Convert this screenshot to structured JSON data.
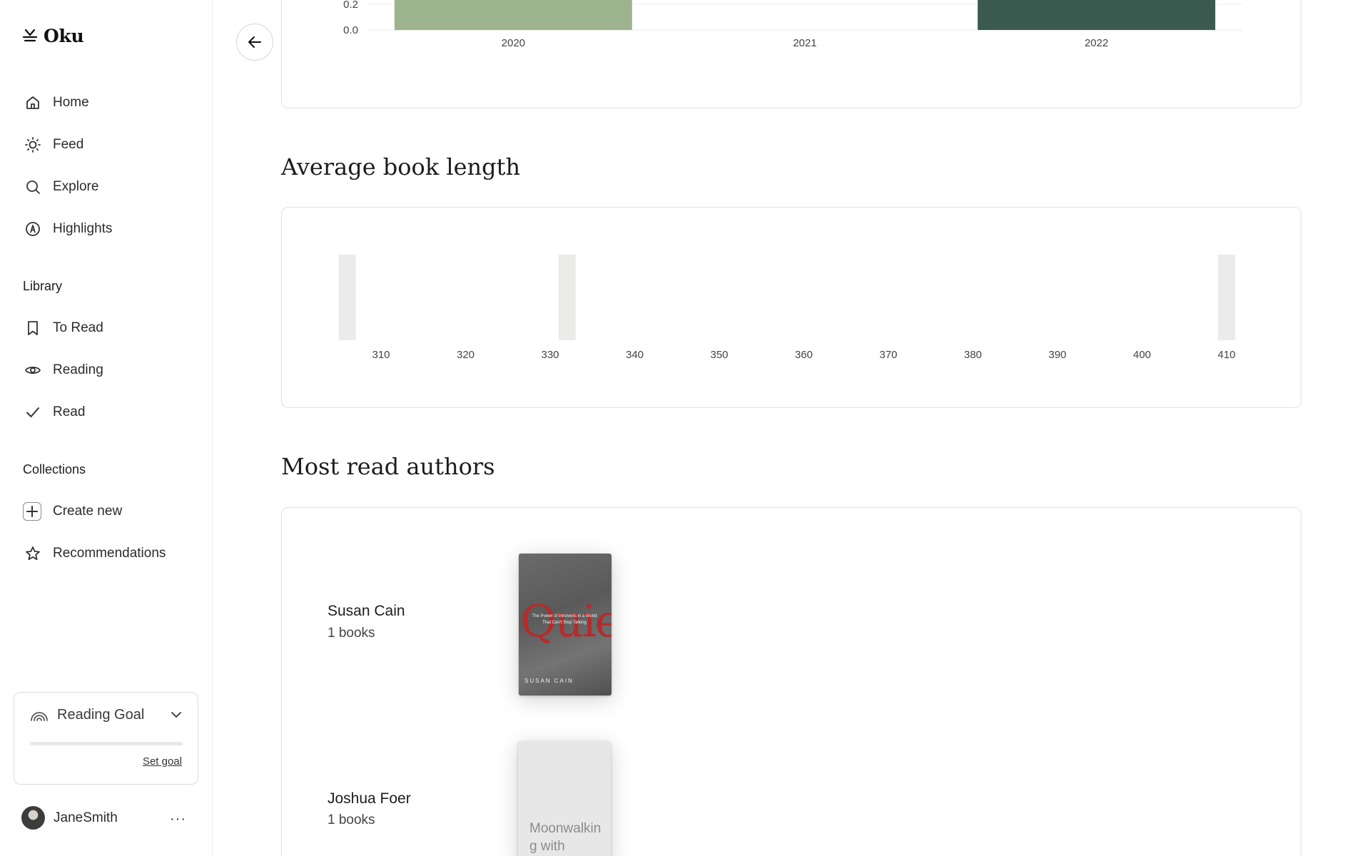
{
  "app": {
    "name": "Oku"
  },
  "sidebar": {
    "nav": [
      {
        "label": "Home",
        "icon": "home-icon"
      },
      {
        "label": "Feed",
        "icon": "sun-icon"
      },
      {
        "label": "Explore",
        "icon": "search-icon"
      },
      {
        "label": "Highlights",
        "icon": "highlights-icon"
      }
    ],
    "library_heading": "Library",
    "library": [
      {
        "label": "To Read",
        "icon": "bookmark-icon"
      },
      {
        "label": "Reading",
        "icon": "eye-icon"
      },
      {
        "label": "Read",
        "icon": "check-icon"
      }
    ],
    "collections_heading": "Collections",
    "collections": [
      {
        "label": "Create new",
        "icon": "plus-icon"
      },
      {
        "label": "Recommendations",
        "icon": "star-icon"
      }
    ],
    "reading_goal": {
      "title": "Reading Goal",
      "link": "Set goal",
      "progress": 0
    },
    "user": {
      "name": "JaneSmith",
      "more": "···"
    }
  },
  "sections": {
    "avg_length_title": "Average book length",
    "authors_title": "Most read authors"
  },
  "chart_data": [
    {
      "type": "bar",
      "categories": [
        "2020",
        "2021",
        "2022"
      ],
      "values": [
        1,
        0,
        1
      ],
      "y_ticks_visible": [
        "0.2",
        "0.0"
      ],
      "colors": [
        "#9db38e",
        "#9db38e",
        "#3b5a4f"
      ]
    },
    {
      "type": "bar",
      "x_ticks": [
        "310",
        "320",
        "330",
        "340",
        "350",
        "360",
        "370",
        "380",
        "390",
        "400",
        "410"
      ],
      "bars_at": [
        306,
        332,
        410
      ],
      "color": "#ebebea"
    }
  ],
  "authors": [
    {
      "name": "Susan Cain",
      "count": "1 books",
      "cover": {
        "title": "Quiet",
        "subtitle": "The Power of Introverts in a World That Can't Stop Talking",
        "author": "SUSAN CAIN"
      }
    },
    {
      "name": "Joshua Foer",
      "count": "1 books",
      "cover": {
        "title": "Moonwalking with"
      }
    }
  ],
  "colors": {
    "accent_dark": "#3b5a4f",
    "accent_light": "#9db38e",
    "border": "#e2e2e2"
  }
}
